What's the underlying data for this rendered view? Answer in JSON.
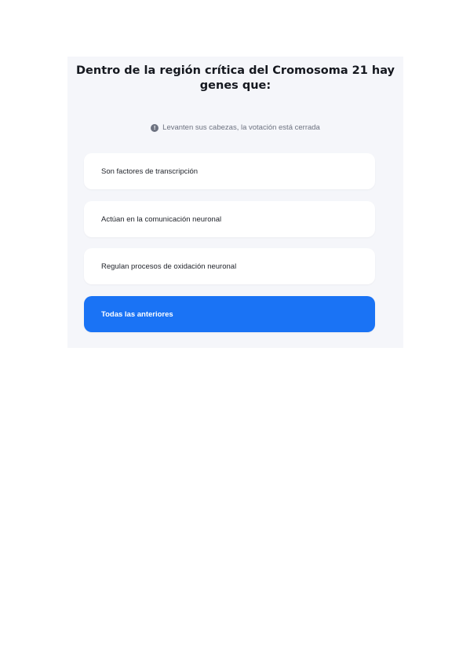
{
  "poll": {
    "question": "Dentro de la región crítica del Cromosoma 21 hay genes que:",
    "status_icon": "info-icon",
    "status_text": "Levanten sus cabezas, la votación está cerrada",
    "options": [
      {
        "label": "Son factores de transcripción",
        "selected": false
      },
      {
        "label": "Actúan en la comunicación neuronal",
        "selected": false
      },
      {
        "label": "Regulan procesos de oxidación neuronal",
        "selected": false
      },
      {
        "label": "Todas las anteriores",
        "selected": true
      }
    ]
  },
  "colors": {
    "card_background": "#f5f6fa",
    "selected_option": "#1a73f5",
    "option_background": "#ffffff"
  }
}
